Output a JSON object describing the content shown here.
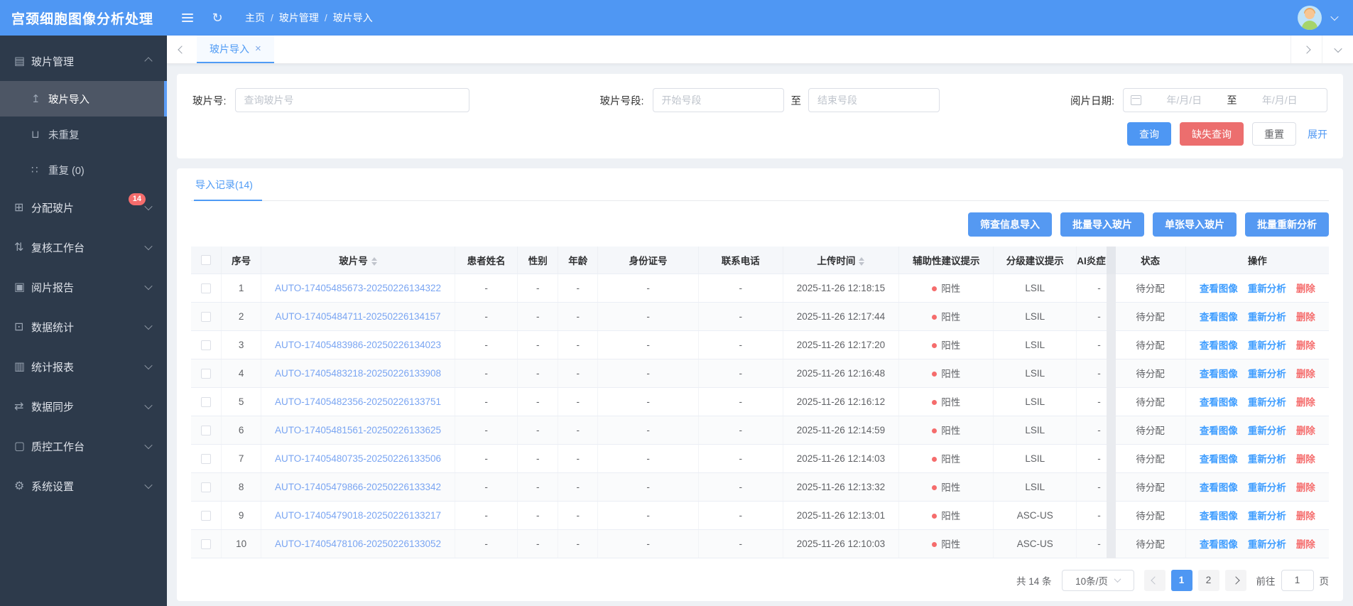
{
  "app": {
    "title": "宫颈细胞图像分析处理"
  },
  "colors": {
    "accent": "#4e97f3",
    "danger": "#ec6e6e",
    "badge": "#f56c6c",
    "positive_dot": "#f56c6c",
    "sidebar_bg": "#2d3a4b"
  },
  "header": {
    "breadcrumb": [
      "主页",
      "玻片管理",
      "玻片导入"
    ],
    "separator": "/"
  },
  "sidebar": {
    "items": [
      {
        "name": "sidebar-item-slide-management",
        "icon": "slides-icon",
        "glyph": "▤",
        "label": "玻片管理",
        "arrow": "up",
        "children": [
          {
            "name": "sidebar-item-slide-import",
            "icon": "upload-icon",
            "glyph": "↥",
            "label": "玻片导入",
            "active": true
          },
          {
            "name": "sidebar-item-not-duplicated",
            "icon": "unique-icon",
            "glyph": "⊔",
            "label": "未重复"
          },
          {
            "name": "sidebar-item-duplicated",
            "icon": "duplicate-icon",
            "glyph": "∷",
            "label": "重复  (0)"
          }
        ]
      },
      {
        "name": "sidebar-item-assign-slides",
        "icon": "assign-icon",
        "glyph": "⊞",
        "label": "分配玻片",
        "badge": "14",
        "arrow": "down"
      },
      {
        "name": "sidebar-item-review-workbench",
        "icon": "review-icon",
        "glyph": "⇅",
        "label": "复核工作台",
        "arrow": "down"
      },
      {
        "name": "sidebar-item-reading-report",
        "icon": "report-icon",
        "glyph": "▣",
        "label": "阅片报告",
        "arrow": "down"
      },
      {
        "name": "sidebar-item-data-statistics",
        "icon": "statistics-icon",
        "glyph": "⊡",
        "label": "数据统计",
        "arrow": "down"
      },
      {
        "name": "sidebar-item-statistical-reports",
        "icon": "bar-chart-icon",
        "glyph": "▥",
        "label": "统计报表",
        "arrow": "down"
      },
      {
        "name": "sidebar-item-data-sync",
        "icon": "sync-icon",
        "glyph": "⇄",
        "label": "数据同步",
        "arrow": "down"
      },
      {
        "name": "sidebar-item-qc-workbench",
        "icon": "qc-document-icon",
        "glyph": "▢",
        "label": "质控工作台",
        "arrow": "down"
      },
      {
        "name": "sidebar-item-system-settings",
        "icon": "gear-icon",
        "glyph": "⚙",
        "label": "系统设置",
        "arrow": "down"
      }
    ]
  },
  "tabs": {
    "active_label": "玻片导入",
    "close_glyph": "×"
  },
  "filters": {
    "slide_no_label": "玻片号:",
    "slide_no_placeholder": "查询玻片号",
    "range_label": "玻片号段:",
    "range_start_placeholder": "开始号段",
    "range_to": "至",
    "range_end_placeholder": "结束号段",
    "date_label": "阅片日期:",
    "date_start_placeholder": "年/月/日",
    "date_to": "至",
    "date_end_placeholder": "年/月/日",
    "buttons": {
      "search": "查询",
      "missing": "缺失查询",
      "reset": "重置",
      "expand": "展开"
    }
  },
  "records": {
    "tab_label": "导入记录(14)",
    "actions": [
      {
        "name": "screening-info-import-button",
        "label": "筛查信息导入"
      },
      {
        "name": "batch-import-slides-button",
        "label": "批量导入玻片"
      },
      {
        "name": "single-import-slide-button",
        "label": "单张导入玻片"
      },
      {
        "name": "batch-reanalyze-button",
        "label": "批量重新分析"
      }
    ],
    "table": {
      "columns": [
        {
          "key": "index",
          "label": "序号",
          "cls": "no"
        },
        {
          "key": "slide",
          "label": "玻片号",
          "cls": "slide",
          "sortable": true,
          "type": "link"
        },
        {
          "key": "patient_name",
          "label": "患者姓名",
          "cls": "name"
        },
        {
          "key": "sex",
          "label": "性别",
          "cls": "sex"
        },
        {
          "key": "age",
          "label": "年龄",
          "cls": "age"
        },
        {
          "key": "id_card",
          "label": "身份证号",
          "cls": "idcard"
        },
        {
          "key": "phone",
          "label": "联系电话",
          "cls": "phone"
        },
        {
          "key": "upload_time",
          "label": "上传时间",
          "cls": "time",
          "sortable": true
        },
        {
          "key": "aux_hint",
          "label": "辅助性建议提示",
          "cls": "aux",
          "type": "dot"
        },
        {
          "key": "grade_hint",
          "label": "分级建议提示",
          "cls": "grade"
        },
        {
          "key": "ai_inflam",
          "label": "AI炎症",
          "cls": "ai"
        },
        {
          "key": "status",
          "label": "状态",
          "cls": "status-col"
        },
        {
          "key": "ops",
          "label": "操作",
          "cls": "ops",
          "type": "ops"
        }
      ],
      "row_actions": [
        {
          "name": "view-image-link",
          "label": "查看图像",
          "color": "op-blue"
        },
        {
          "name": "reanalyze-link",
          "label": "重新分析",
          "color": "op-blue"
        },
        {
          "name": "delete-link",
          "label": "删除",
          "color": "op-red"
        }
      ],
      "rows": [
        {
          "index": "1",
          "slide": "AUTO-17405485673-20250226134322",
          "patient_name": "-",
          "sex": "-",
          "age": "-",
          "id_card": "-",
          "phone": "-",
          "upload_time": "2025-11-26 12:18:15",
          "aux_hint": "阳性",
          "grade_hint": "LSIL",
          "ai_inflam": "-",
          "status": "待分配"
        },
        {
          "index": "2",
          "slide": "AUTO-17405484711-20250226134157",
          "patient_name": "-",
          "sex": "-",
          "age": "-",
          "id_card": "-",
          "phone": "-",
          "upload_time": "2025-11-26 12:17:44",
          "aux_hint": "阳性",
          "grade_hint": "LSIL",
          "ai_inflam": "-",
          "status": "待分配"
        },
        {
          "index": "3",
          "slide": "AUTO-17405483986-20250226134023",
          "patient_name": "-",
          "sex": "-",
          "age": "-",
          "id_card": "-",
          "phone": "-",
          "upload_time": "2025-11-26 12:17:20",
          "aux_hint": "阳性",
          "grade_hint": "LSIL",
          "ai_inflam": "-",
          "status": "待分配"
        },
        {
          "index": "4",
          "slide": "AUTO-17405483218-20250226133908",
          "patient_name": "-",
          "sex": "-",
          "age": "-",
          "id_card": "-",
          "phone": "-",
          "upload_time": "2025-11-26 12:16:48",
          "aux_hint": "阳性",
          "grade_hint": "LSIL",
          "ai_inflam": "-",
          "status": "待分配"
        },
        {
          "index": "5",
          "slide": "AUTO-17405482356-20250226133751",
          "patient_name": "-",
          "sex": "-",
          "age": "-",
          "id_card": "-",
          "phone": "-",
          "upload_time": "2025-11-26 12:16:12",
          "aux_hint": "阳性",
          "grade_hint": "LSIL",
          "ai_inflam": "-",
          "status": "待分配"
        },
        {
          "index": "6",
          "slide": "AUTO-17405481561-20250226133625",
          "patient_name": "-",
          "sex": "-",
          "age": "-",
          "id_card": "-",
          "phone": "-",
          "upload_time": "2025-11-26 12:14:59",
          "aux_hint": "阳性",
          "grade_hint": "LSIL",
          "ai_inflam": "-",
          "status": "待分配"
        },
        {
          "index": "7",
          "slide": "AUTO-17405480735-20250226133506",
          "patient_name": "-",
          "sex": "-",
          "age": "-",
          "id_card": "-",
          "phone": "-",
          "upload_time": "2025-11-26 12:14:03",
          "aux_hint": "阳性",
          "grade_hint": "LSIL",
          "ai_inflam": "-",
          "status": "待分配"
        },
        {
          "index": "8",
          "slide": "AUTO-17405479866-20250226133342",
          "patient_name": "-",
          "sex": "-",
          "age": "-",
          "id_card": "-",
          "phone": "-",
          "upload_time": "2025-11-26 12:13:32",
          "aux_hint": "阳性",
          "grade_hint": "LSIL",
          "ai_inflam": "-",
          "status": "待分配"
        },
        {
          "index": "9",
          "slide": "AUTO-17405479018-20250226133217",
          "patient_name": "-",
          "sex": "-",
          "age": "-",
          "id_card": "-",
          "phone": "-",
          "upload_time": "2025-11-26 12:13:01",
          "aux_hint": "阳性",
          "grade_hint": "ASC-US",
          "ai_inflam": "-",
          "status": "待分配"
        },
        {
          "index": "10",
          "slide": "AUTO-17405478106-20250226133052",
          "patient_name": "-",
          "sex": "-",
          "age": "-",
          "id_card": "-",
          "phone": "-",
          "upload_time": "2025-11-26 12:10:03",
          "aux_hint": "阳性",
          "grade_hint": "ASC-US",
          "ai_inflam": "-",
          "status": "待分配"
        }
      ]
    },
    "pagination": {
      "total": "共 14 条",
      "page_size": "10条/页",
      "pages": [
        "1",
        "2"
      ],
      "active_page": "1",
      "goto_label": "前往",
      "goto_value": "1",
      "page_unit": "页"
    }
  }
}
